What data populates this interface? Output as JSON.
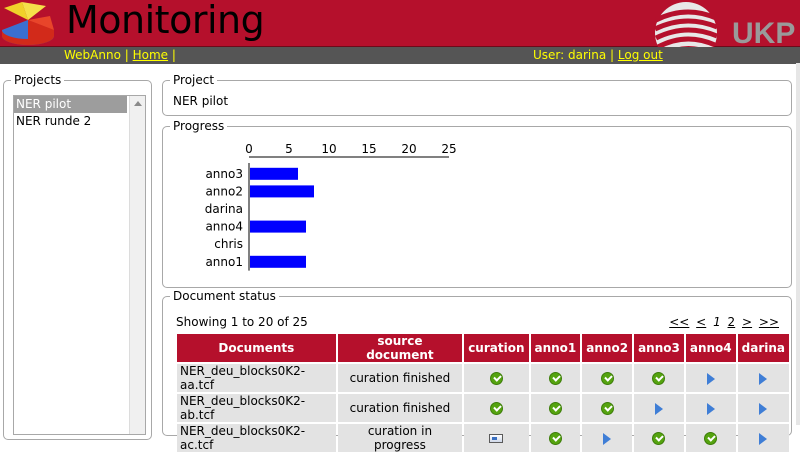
{
  "header": {
    "title": "Monitoring",
    "logo_text": "UKP",
    "nav": {
      "webanno": "WebAnno",
      "home": "Home",
      "user_label": "User: darina",
      "logout": "Log out"
    }
  },
  "projects": {
    "legend": "Projects",
    "items": [
      "NER pilot",
      "NER runde 2"
    ],
    "selected": "NER pilot"
  },
  "project": {
    "legend": "Project",
    "name": "NER pilot"
  },
  "progress": {
    "legend": "Progress",
    "chart_data": {
      "type": "bar",
      "orientation": "horizontal",
      "categories": [
        "anno3",
        "anno2",
        "darina",
        "anno4",
        "chris",
        "anno1"
      ],
      "values": [
        6,
        8,
        0,
        7,
        0,
        7
      ],
      "xlim": [
        0,
        25
      ],
      "ticks": [
        0,
        5,
        10,
        15,
        20,
        25
      ],
      "bar_color": "#0000ff"
    }
  },
  "documents": {
    "legend": "Document status",
    "showing": "Showing 1 to 20 of 25",
    "pager": {
      "first": "<<",
      "prev": "<",
      "page1": "1",
      "page2": "2",
      "next": ">",
      "last": ">>"
    },
    "columns": [
      "Documents",
      "source document",
      "curation",
      "anno1",
      "anno2",
      "anno3",
      "anno4",
      "darina"
    ],
    "rows": [
      {
        "name": "NER_deu_blocks0K2-aa.tcf",
        "source": "curation finished",
        "cells": [
          "check",
          "check",
          "check",
          "check",
          "play",
          "play"
        ]
      },
      {
        "name": "NER_deu_blocks0K2-ab.tcf",
        "source": "curation finished",
        "cells": [
          "check",
          "check",
          "check",
          "play",
          "play",
          "play"
        ]
      },
      {
        "name": "NER_deu_blocks0K2-ac.tcf",
        "source": "curation in progress",
        "cells": [
          "progress",
          "check",
          "play",
          "check",
          "check",
          "play"
        ]
      }
    ]
  },
  "colors": {
    "header_red": "#b5102c",
    "nav_gray": "#555555",
    "nav_text": "#ffff00",
    "bar_blue": "#0000ff"
  }
}
